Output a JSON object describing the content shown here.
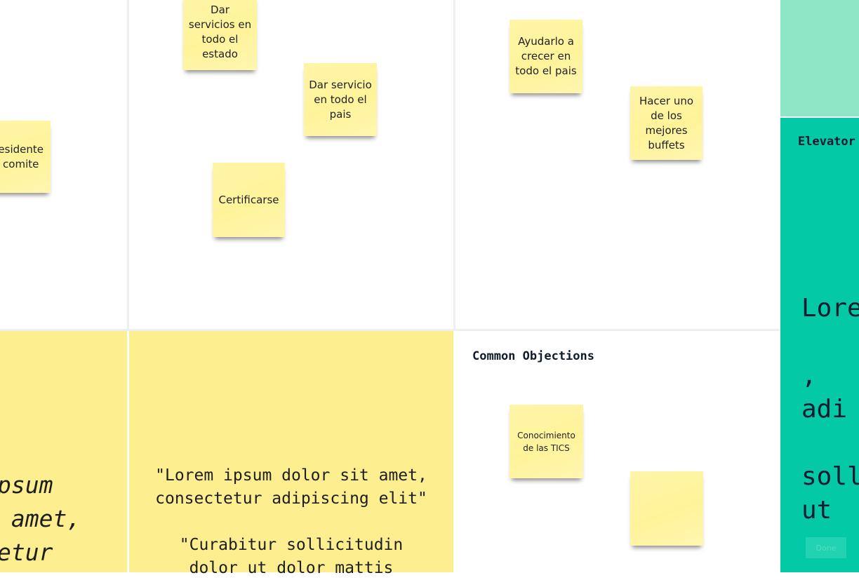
{
  "colors": {
    "board_bg": "#ffffff",
    "sticky_yellow": "#fff39a",
    "quote_yellow": "#fdee90",
    "teal": "#04c9a6",
    "teal_light": "#8ee6c6"
  },
  "stickies": {
    "servicios_estado": "Dar\nservicios en\ntodo el\nestado",
    "servicio_pais": "Dar servicio\nen todo el\npais",
    "certificarse": "Certificarse",
    "presidente": "esidente\ncomite",
    "crecer": "Ayudarlo a\ncrecer en\ntodo el pais",
    "buffets": "Hacer uno\nde los\nmejores\nbuffets",
    "tics": "Conocimiento\nde las TICS",
    "blank": ""
  },
  "sections": {
    "common_objections": "Common Objections",
    "elevator": "Elevator"
  },
  "quotes": {
    "left_partial": "psum\n amet,\netur",
    "center": "\"Lorem ipsum dolor sit amet,\nconsectetur adipiscing elit\"\n\n\"Curabitur sollicitudin\ndolor ut dolor mattis",
    "right_partial": "Lore\n\n,\nadi\n\nsoll\nut"
  },
  "elevator_button": "Done"
}
